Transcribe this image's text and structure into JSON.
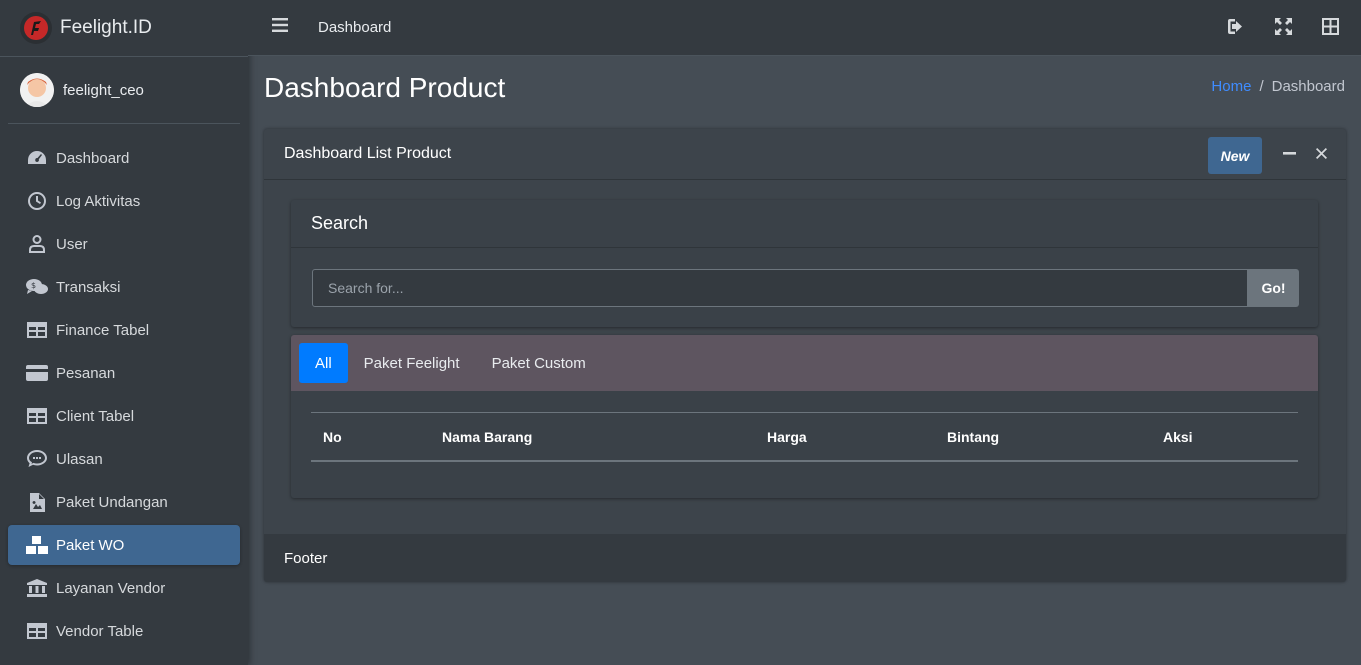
{
  "brand": {
    "name": "Feelight.ID",
    "logo_icon": "feelight-logo-icon"
  },
  "user": {
    "name": "feelight_ceo",
    "avatar_icon": "avatar-icon"
  },
  "sidebar": {
    "items": [
      {
        "label": "Dashboard",
        "icon": "tachometer-icon"
      },
      {
        "label": "Log Aktivitas",
        "icon": "clock-icon"
      },
      {
        "label": "User",
        "icon": "user-icon"
      },
      {
        "label": "Transaksi",
        "icon": "comments-dollar-icon"
      },
      {
        "label": "Finance Tabel",
        "icon": "table-icon"
      },
      {
        "label": "Pesanan",
        "icon": "credit-card-icon"
      },
      {
        "label": "Client Tabel",
        "icon": "table-icon"
      },
      {
        "label": "Ulasan",
        "icon": "comment-icon"
      },
      {
        "label": "Paket Undangan",
        "icon": "file-image-icon"
      },
      {
        "label": "Paket WO",
        "icon": "boxes-icon",
        "active": true
      },
      {
        "label": "Layanan Vendor",
        "icon": "university-icon"
      },
      {
        "label": "Vendor Table",
        "icon": "table-icon"
      }
    ]
  },
  "topbar": {
    "title": "Dashboard",
    "icons": [
      "menu-icon",
      "sign-out-icon",
      "fullscreen-icon",
      "grid-icon"
    ]
  },
  "content": {
    "title": "Dashboard Product",
    "breadcrumb": {
      "home": "Home",
      "separator": "/",
      "current": "Dashboard"
    }
  },
  "card": {
    "title": "Dashboard List Product",
    "new_label": "New",
    "search": {
      "title": "Search",
      "placeholder": "Search for...",
      "go_label": "Go!"
    },
    "tabs": [
      "All",
      "Paket Feelight",
      "Paket Custom"
    ],
    "active_tab": "All",
    "table": {
      "columns": [
        "No",
        "Nama Barang",
        "Harga",
        "Bintang",
        "Aksi"
      ],
      "rows": []
    },
    "footer": "Footer"
  },
  "colors": {
    "sidebar_bg": "#343a40",
    "content_bg": "#454d55",
    "active_nav": "#3f6791",
    "primary": "#007bff",
    "tabs_bg": "#5e5560",
    "link": "#3f8cff"
  }
}
